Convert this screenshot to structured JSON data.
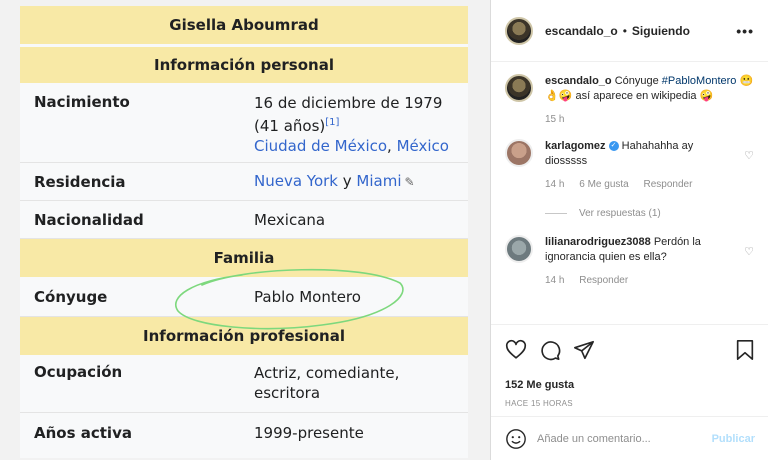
{
  "infobox": {
    "title": "Gisella Aboumrad",
    "section_personal": "Información personal",
    "rows_personal": [
      {
        "label": "Nacimiento",
        "line1": "16 de diciembre de 1979",
        "line2": "(41 años)",
        "ref": "[1]",
        "city": "Ciudad de México",
        "sep": ", ",
        "country": "México"
      },
      {
        "label": "Residencia",
        "place1": "Nueva York",
        "conj": " y ",
        "place2": "Miami"
      },
      {
        "label": "Nacionalidad",
        "value": "Mexicana"
      }
    ],
    "section_family": "Familia",
    "spouse": {
      "label": "Cónyuge",
      "value": "Pablo Montero"
    },
    "section_professional": "Información profesional",
    "occupation": {
      "label": "Ocupación",
      "line1": "Actriz, comediante,",
      "line2": "escritora"
    },
    "active": {
      "label": "Años activa",
      "value": "1999-presente"
    },
    "annotation_color": "#7dd87d"
  },
  "instagram": {
    "header": {
      "username": "escandalo_o",
      "dot": "•",
      "status": "Siguiendo",
      "more": "•••"
    },
    "caption": {
      "username": "escandalo_o",
      "text_prefix": "Cónyuge ",
      "hashtag": "#PabloMontero",
      "emojis": "😬👌🤪",
      "text_suffix": " así aparece en wikipedia ",
      "emoji_end": "🤪",
      "time": "15 h"
    },
    "comments": [
      {
        "username": "karlagomez",
        "verified": true,
        "text": "Hahahahha ay diosssss",
        "time": "14 h",
        "likes": "6 Me gusta",
        "reply": "Responder",
        "view_replies": "Ver respuestas (1)"
      },
      {
        "username": "lilianarodriguez3088",
        "verified": false,
        "text": "Perdón la ignorancia quien es ella?",
        "time": "14 h",
        "reply": "Responder"
      }
    ],
    "likes": "152 Me gusta",
    "posted": "HACE 15 HORAS",
    "add_comment_placeholder": "Añade un comentario...",
    "publish": "Publicar",
    "icons": [
      "heart-icon",
      "comment-icon",
      "share-icon",
      "bookmark-icon",
      "emoji-icon"
    ]
  }
}
